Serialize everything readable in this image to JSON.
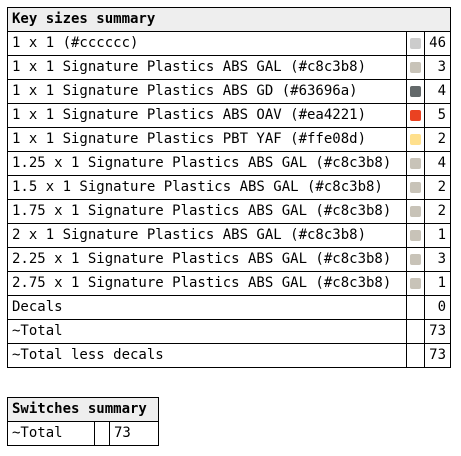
{
  "key_summary": {
    "title": "Key sizes summary",
    "rows": [
      {
        "name": "1 x 1 (#cccccc)",
        "color": "#cccccc",
        "count": "46"
      },
      {
        "name": "1 x 1 Signature Plastics ABS GAL (#c8c3b8)",
        "color": "#c8c3b8",
        "count": "3"
      },
      {
        "name": "1 x 1 Signature Plastics ABS GD (#63696a)",
        "color": "#63696a",
        "count": "4"
      },
      {
        "name": "1 x 1 Signature Plastics ABS OAV (#ea4221)",
        "color": "#ea4221",
        "count": "5"
      },
      {
        "name": "1 x 1 Signature Plastics PBT YAF (#ffe08d)",
        "color": "#ffe08d",
        "count": "2"
      },
      {
        "name": "1.25 x 1 Signature Plastics ABS GAL (#c8c3b8)",
        "color": "#c8c3b8",
        "count": "4"
      },
      {
        "name": "1.5 x 1 Signature Plastics ABS GAL (#c8c3b8)",
        "color": "#c8c3b8",
        "count": "2"
      },
      {
        "name": "1.75 x 1 Signature Plastics ABS GAL (#c8c3b8)",
        "color": "#c8c3b8",
        "count": "2"
      },
      {
        "name": "2 x 1 Signature Plastics ABS GAL (#c8c3b8)",
        "color": "#c8c3b8",
        "count": "1"
      },
      {
        "name": "2.25 x 1 Signature Plastics ABS GAL (#c8c3b8)",
        "color": "#c8c3b8",
        "count": "3"
      },
      {
        "name": "2.75 x 1 Signature Plastics ABS GAL (#c8c3b8)",
        "color": "#c8c3b8",
        "count": "1"
      }
    ],
    "decals": {
      "label": "Decals",
      "count": "0"
    },
    "total": {
      "label": "~Total",
      "count": "73"
    },
    "total_less_decals": {
      "label": "~Total less decals",
      "count": "73"
    }
  },
  "switch_summary": {
    "title": "Switches summary",
    "total": {
      "label": "~Total",
      "count": "73"
    }
  }
}
